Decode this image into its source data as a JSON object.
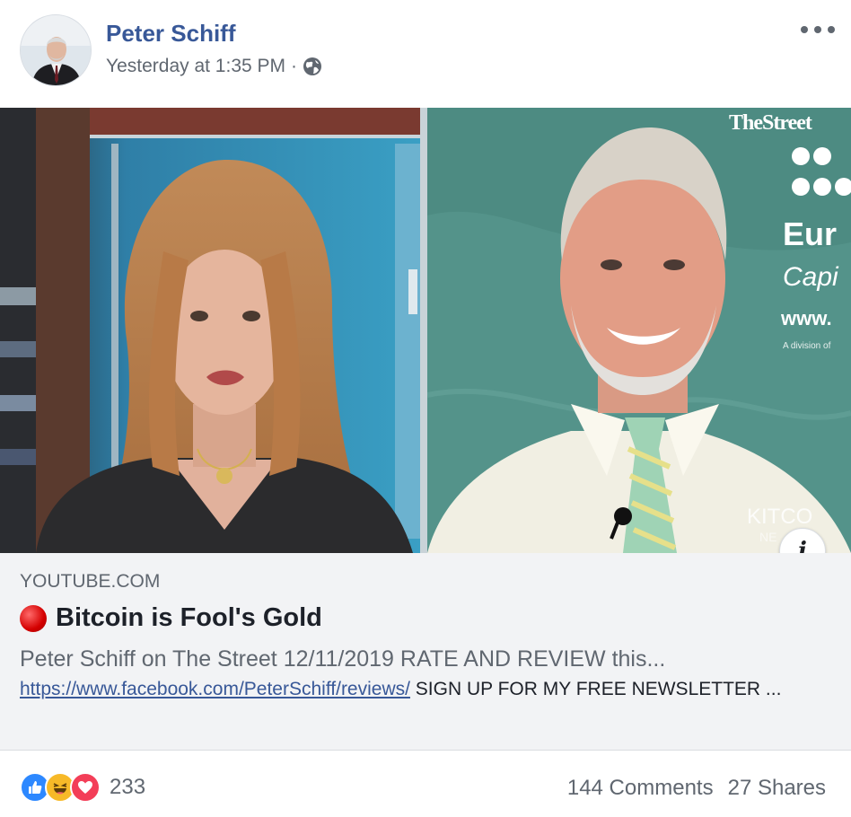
{
  "post": {
    "author": "Peter Schiff",
    "timestamp": "Yesterday at 1:35 PM",
    "separator": "·",
    "privacy_icon": "globe-icon",
    "options_icon": "more-horizontal-icon"
  },
  "media": {
    "left_panel": "female-anchor-in-studio",
    "right_panel": "peter-schiff-remote-feed",
    "overlay_brand": "TheStreet",
    "overlay_text_1": "Eur",
    "overlay_text_2": "Capi",
    "overlay_text_3": "www.",
    "overlay_text_4": "A division of",
    "overlay_corner": "KITCO",
    "overlay_corner_sub": "NE",
    "info_icon": "info-icon"
  },
  "link": {
    "domain": "YOUTUBE.COM",
    "title": "Bitcoin is Fool's Gold",
    "description": "Peter Schiff on The Street 12/11/2019 RATE AND REVIEW this...",
    "url": "https://www.facebook.com/PeterSchiff/reviews/",
    "description_tail": " SIGN UP FOR MY FREE NEWSLETTER ..."
  },
  "engagement": {
    "reactions": [
      "like-icon",
      "haha-icon",
      "love-icon"
    ],
    "reaction_count": "233",
    "comments": "144 Comments",
    "shares": "27 Shares"
  },
  "colors": {
    "author_link": "#385898",
    "link_bg": "#f2f3f5",
    "like": "#2d88ff",
    "haha": "#f7b928",
    "love": "#f33e58"
  }
}
